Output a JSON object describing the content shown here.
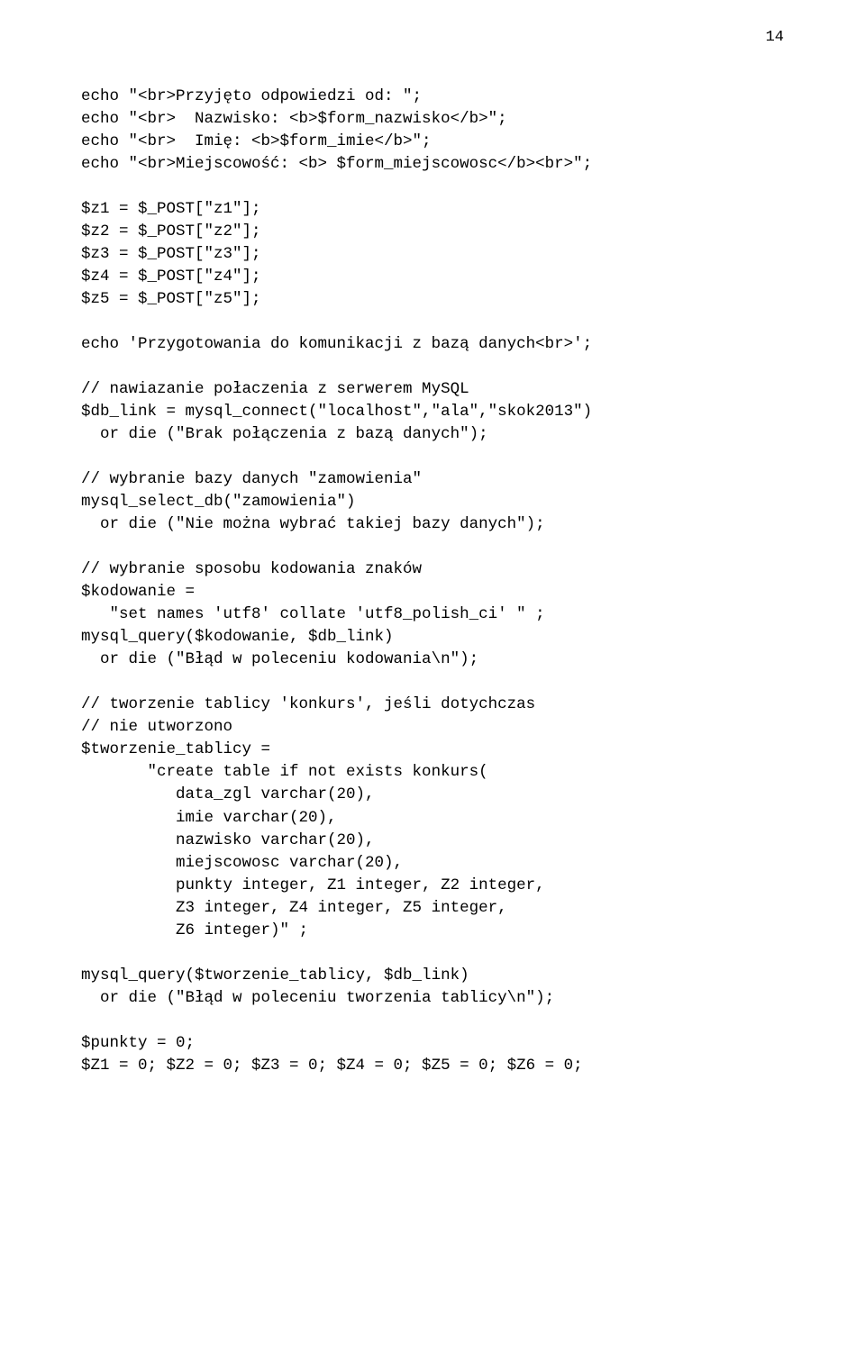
{
  "pageNumber": "14",
  "lines": [
    "echo \"<br>Przyjęto odpowiedzi od: \";",
    "echo \"<br>  Nazwisko: <b>$form_nazwisko</b>\";",
    "echo \"<br>  Imię: <b>$form_imie</b>\";",
    "echo \"<br>Miejscowość: <b> $form_miejscowosc</b><br>\";",
    "",
    "$z1 = $_POST[\"z1\"];",
    "$z2 = $_POST[\"z2\"];",
    "$z3 = $_POST[\"z3\"];",
    "$z4 = $_POST[\"z4\"];",
    "$z5 = $_POST[\"z5\"];",
    "",
    "echo 'Przygotowania do komunikacji z bazą danych<br>';",
    "",
    "// nawiazanie połaczenia z serwerem MySQL",
    "$db_link = mysql_connect(\"localhost\",\"ala\",\"skok2013\")",
    "  or die (\"Brak połączenia z bazą danych\");",
    "",
    "// wybranie bazy danych \"zamowienia\"",
    "mysql_select_db(\"zamowienia\")",
    "  or die (\"Nie można wybrać takiej bazy danych\");",
    "",
    "// wybranie sposobu kodowania znaków",
    "$kodowanie =",
    "   \"set names 'utf8' collate 'utf8_polish_ci' \" ;",
    "mysql_query($kodowanie, $db_link)",
    "  or die (\"Błąd w poleceniu kodowania\\n\");",
    "",
    "// tworzenie tablicy 'konkurs', jeśli dotychczas",
    "// nie utworzono",
    "$tworzenie_tablicy =",
    "       \"create table if not exists konkurs(",
    "          data_zgl varchar(20),",
    "          imie varchar(20),",
    "          nazwisko varchar(20),",
    "          miejscowosc varchar(20),",
    "          punkty integer, Z1 integer, Z2 integer,",
    "          Z3 integer, Z4 integer, Z5 integer,",
    "          Z6 integer)\" ;",
    "",
    "mysql_query($tworzenie_tablicy, $db_link)",
    "  or die (\"Błąd w poleceniu tworzenia tablicy\\n\");",
    "",
    "$punkty = 0;",
    "$Z1 = 0; $Z2 = 0; $Z3 = 0; $Z4 = 0; $Z5 = 0; $Z6 = 0;"
  ]
}
